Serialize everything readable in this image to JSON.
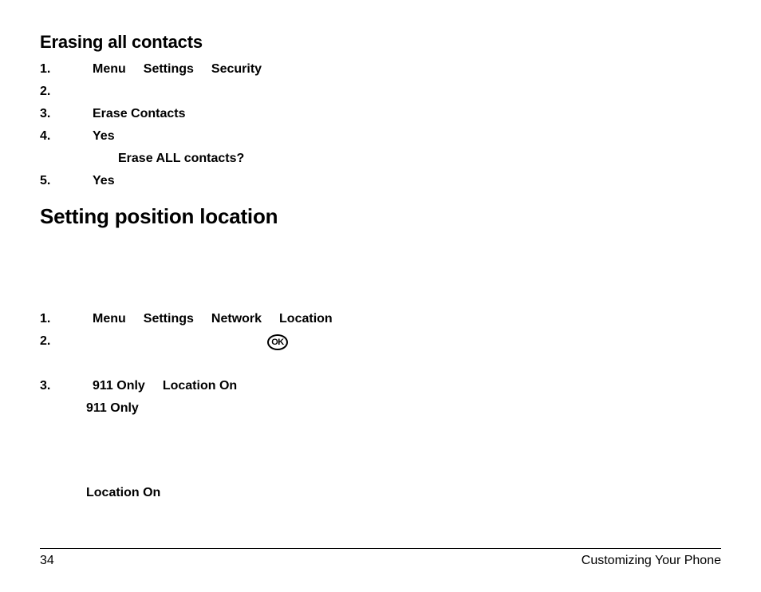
{
  "section1": {
    "title": "Erasing all contacts",
    "steps": {
      "s1": {
        "num": "1.",
        "items": [
          "Menu",
          "Settings",
          "Security"
        ]
      },
      "s2": {
        "num": "2."
      },
      "s3": {
        "num": "3.",
        "items": [
          "Erase Contacts"
        ]
      },
      "s4": {
        "num": "4.",
        "items": [
          "Yes"
        ]
      },
      "s4sub": "Erase ALL contacts?",
      "s5": {
        "num": "5.",
        "items": [
          "Yes"
        ]
      }
    }
  },
  "section2": {
    "title": "Setting position location",
    "steps": {
      "s1": {
        "num": "1.",
        "items": [
          "Menu",
          "Settings",
          "Network",
          "Location"
        ]
      },
      "s2": {
        "num": "2."
      },
      "s3": {
        "num": "3.",
        "items": [
          "911 Only",
          "Location On"
        ]
      },
      "s3sub1": "911 Only",
      "s3sub2": "Location On"
    }
  },
  "ok_label": "OK",
  "footer": {
    "page": "34",
    "chapter": "Customizing Your Phone"
  }
}
